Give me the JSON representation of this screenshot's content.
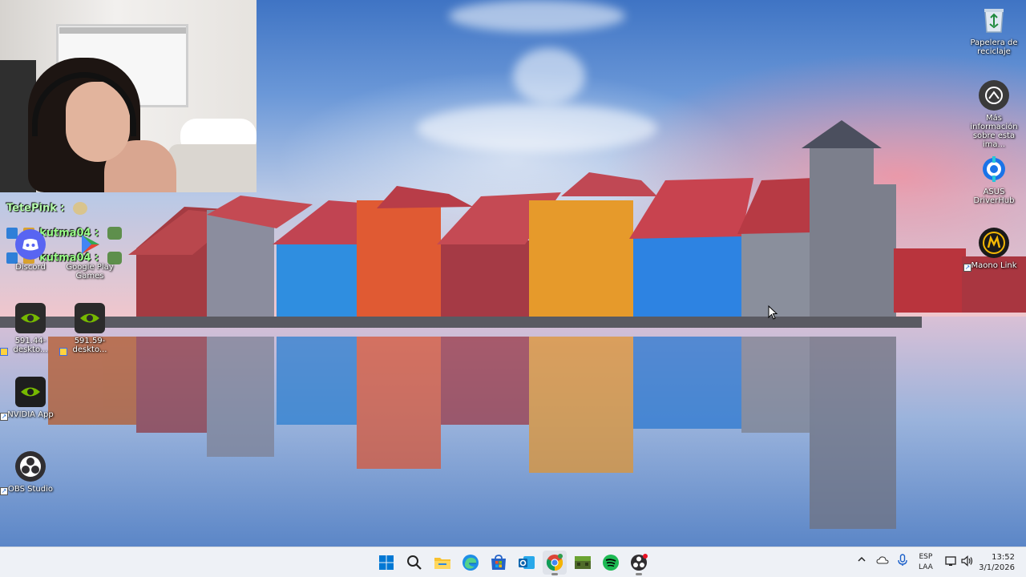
{
  "chat": {
    "line1_user": "TetePink",
    "line1_sep": ":",
    "line2_user": "kutma04",
    "line2_sep": ":",
    "line3_user": "kutma04",
    "line3_sep": ":"
  },
  "desktop_icons": {
    "recycle_bin": "Papelera de reciclaje",
    "more_info": "Más información sobre esta ima...",
    "asus": "ASUS DriverHub",
    "maono": "Maono Link",
    "discord": "Discord",
    "google_play": "Google Play Games",
    "nvidia1": "591.44-deskto...",
    "nvidia2": "591.59-deskto...",
    "nvidia_app": "NVIDIA App",
    "obs": "OBS Studio"
  },
  "taskbar": {
    "apps": [
      "start-icon",
      "search-icon",
      "file-explorer-icon",
      "edge-icon",
      "store-icon",
      "outlook-icon",
      "chrome-icon",
      "minecraft-icon",
      "spotify-icon",
      "obs-icon"
    ],
    "lang_line1": "ESP",
    "lang_line2": "LAA",
    "time": "13:52",
    "date": "3/1/2026"
  },
  "colors": {
    "taskbar_bg": "#eef1f6",
    "chat_green": "#9bff8a",
    "windows_blue": "#0078d4"
  }
}
